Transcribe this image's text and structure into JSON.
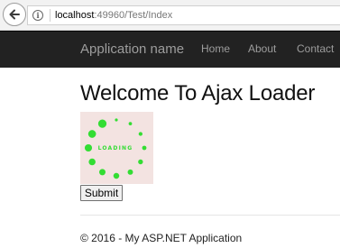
{
  "browser": {
    "url_host": "localhost",
    "url_rest": ":49960/Test/Index",
    "icons": {
      "back": "back-arrow-icon",
      "info": "info-icon"
    }
  },
  "navbar": {
    "brand": "Application name",
    "links": [
      "Home",
      "About",
      "Contact"
    ]
  },
  "main": {
    "title": "Welcome To Ajax Loader",
    "loader_text": "LOADING",
    "loader_color": "#33dd33",
    "submit_label": "Submit"
  },
  "footer": {
    "text": "© 2016 - My ASP.NET Application"
  }
}
